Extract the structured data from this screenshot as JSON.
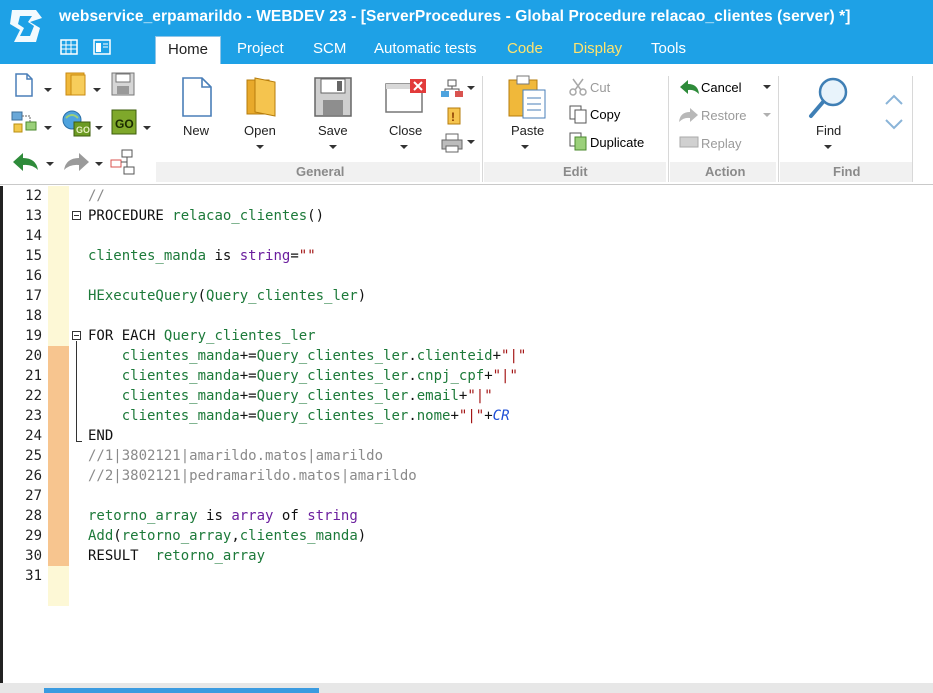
{
  "window": {
    "title": "webservice_erpamarildo - WEBDEV 23 - [ServerProcedures - Global Procedure relacao_clientes (server) *]"
  },
  "tabs": [
    {
      "label": "Home",
      "active": true
    },
    {
      "label": "Project"
    },
    {
      "label": "SCM"
    },
    {
      "label": "Automatic tests"
    },
    {
      "label": "Code",
      "color": "#ffe36e"
    },
    {
      "label": "Display",
      "color": "#ffe36e"
    },
    {
      "label": "Tools"
    }
  ],
  "ribbon": {
    "new_label": "New",
    "open_label": "Open",
    "save_label": "Save",
    "close_label": "Close",
    "paste_label": "Paste",
    "cut_label": "Cut",
    "copy_label": "Copy",
    "duplicate_label": "Duplicate",
    "cancel_label": "Cancel",
    "restore_label": "Restore",
    "replay_label": "Replay",
    "find_label": "Find",
    "groups": {
      "general": "General",
      "edit": "Edit",
      "action": "Action",
      "find": "Find"
    }
  },
  "editor": {
    "lines": [
      {
        "n": "12",
        "text": "//"
      },
      {
        "n": "13",
        "text": "PROCEDURE relacao_clientes()"
      },
      {
        "n": "14",
        "text": ""
      },
      {
        "n": "15",
        "text": "clientes_manda is string=\"\""
      },
      {
        "n": "16",
        "text": ""
      },
      {
        "n": "17",
        "text": "HExecuteQuery(Query_clientes_ler)"
      },
      {
        "n": "18",
        "text": ""
      },
      {
        "n": "19",
        "text": "FOR EACH Query_clientes_ler"
      },
      {
        "n": "20",
        "text": "    clientes_manda+=Query_clientes_ler.clienteid+\"|\""
      },
      {
        "n": "21",
        "text": "    clientes_manda+=Query_clientes_ler.cnpj_cpf+\"|\""
      },
      {
        "n": "22",
        "text": "    clientes_manda+=Query_clientes_ler.email+\"|\""
      },
      {
        "n": "23",
        "text": "    clientes_manda+=Query_clientes_ler.nome+\"|\"+CR"
      },
      {
        "n": "24",
        "text": "END"
      },
      {
        "n": "25",
        "text": "//1|3802121|amarildo.matos|amarildo"
      },
      {
        "n": "26",
        "text": "//2|3802121|pedramarildo.matos|amarildo"
      },
      {
        "n": "27",
        "text": ""
      },
      {
        "n": "28",
        "text": "retorno_array is array of string"
      },
      {
        "n": "29",
        "text": "Add(retorno_array,clientes_manda)"
      },
      {
        "n": "30",
        "text": "RESULT  retorno_array"
      },
      {
        "n": "31",
        "text": ""
      }
    ]
  },
  "colors": {
    "titlebar": "#1ea1e6",
    "keyword": "#111111",
    "identifier": "#1d7a3a",
    "type": "#6b1f9e",
    "comment": "#8a8a8a",
    "string": "#a31515",
    "constant": "#1f4fd6",
    "change_marker": "#f7c58f",
    "margin": "#fdf8d6"
  }
}
